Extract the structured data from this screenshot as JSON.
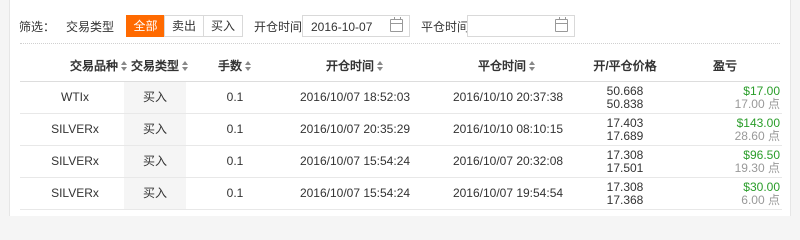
{
  "filter": {
    "label": "筛选：",
    "trade_type_label": "交易类型",
    "options": [
      "全部",
      "卖出",
      "买入"
    ],
    "active_option": "全部",
    "open_time_label": "开仓时间",
    "open_time_value": "2016-10-07",
    "close_time_label": "平仓时间",
    "close_time_value": ""
  },
  "table": {
    "columns": [
      "交易品种",
      "交易类型",
      "手数",
      "开仓时间",
      "平仓时间",
      "开/平仓价格",
      "盈亏"
    ],
    "rows": [
      {
        "symbol": "WTIx",
        "type": "买入",
        "lots": "0.1",
        "open_time": "2016/10/07 18:52:03",
        "close_time": "2016/10/10 20:37:38",
        "open_price": "50.668",
        "close_price": "50.838",
        "pl_money": "$17.00",
        "pl_points": "17.00 点"
      },
      {
        "symbol": "SILVERx",
        "type": "买入",
        "lots": "0.1",
        "open_time": "2016/10/07 20:35:29",
        "close_time": "2016/10/10 08:10:15",
        "open_price": "17.403",
        "close_price": "17.689",
        "pl_money": "$143.00",
        "pl_points": "28.60 点"
      },
      {
        "symbol": "SILVERx",
        "type": "买入",
        "lots": "0.1",
        "open_time": "2016/10/07 15:54:24",
        "close_time": "2016/10/07 20:32:08",
        "open_price": "17.308",
        "close_price": "17.501",
        "pl_money": "$96.50",
        "pl_points": "19.30 点"
      },
      {
        "symbol": "SILVERx",
        "type": "买入",
        "lots": "0.1",
        "open_time": "2016/10/07 15:54:24",
        "close_time": "2016/10/07 19:54:54",
        "open_price": "17.308",
        "close_price": "17.368",
        "pl_money": "$30.00",
        "pl_points": "6.00 点"
      }
    ]
  },
  "colors": {
    "accent": "#ff6a00",
    "profit": "#2a9d2a"
  },
  "icons": {
    "date_picker": "calendar-icon",
    "sort": "sort-icon"
  }
}
